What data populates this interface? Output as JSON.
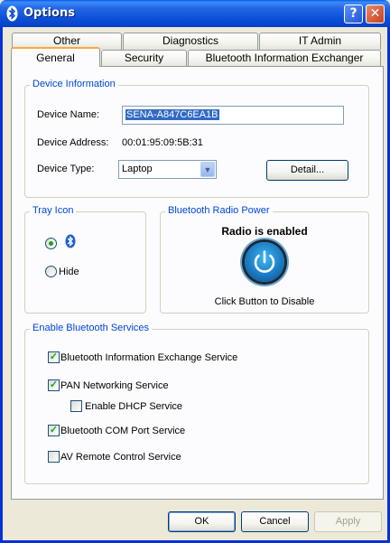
{
  "window": {
    "title": "Options",
    "help_label": "?",
    "close_label": "✕",
    "bt_icon": "bluetooth-icon"
  },
  "tabs": {
    "row1": [
      "Other",
      "Diagnostics",
      "IT Admin"
    ],
    "row2": [
      "General",
      "Security",
      "Bluetooth Information Exchanger"
    ],
    "active": "General"
  },
  "device_info": {
    "legend": "Device Information",
    "name_label": "Device Name:",
    "name_value": "SENA-A847C6EA1B",
    "address_label": "Device Address:",
    "address_value": "00:01:95:09:5B:31",
    "type_label": "Device Type:",
    "type_value": "Laptop",
    "detail_button": "Detail..."
  },
  "tray_icon": {
    "legend": "Tray Icon",
    "show_selected": true,
    "hide_label": "Hide"
  },
  "radio_power": {
    "legend": "Bluetooth Radio Power",
    "status": "Radio is enabled",
    "hint": "Click Button to Disable",
    "icon": "power-icon"
  },
  "services": {
    "legend": "Enable Bluetooth Services",
    "items": [
      {
        "label": "Bluetooth Information Exchange Service",
        "checked": true
      },
      {
        "label": "PAN Networking Service",
        "checked": true
      },
      {
        "label": "Enable DHCP Service",
        "checked": false
      },
      {
        "label": "Bluetooth COM Port Service",
        "checked": true
      },
      {
        "label": "AV Remote Control Service",
        "checked": false
      }
    ]
  },
  "footer": {
    "ok": "OK",
    "cancel": "Cancel",
    "apply": "Apply"
  },
  "colors": {
    "title_blue": "#0a4fd6",
    "legend_blue": "#0046d5",
    "check_green": "#21a121"
  }
}
